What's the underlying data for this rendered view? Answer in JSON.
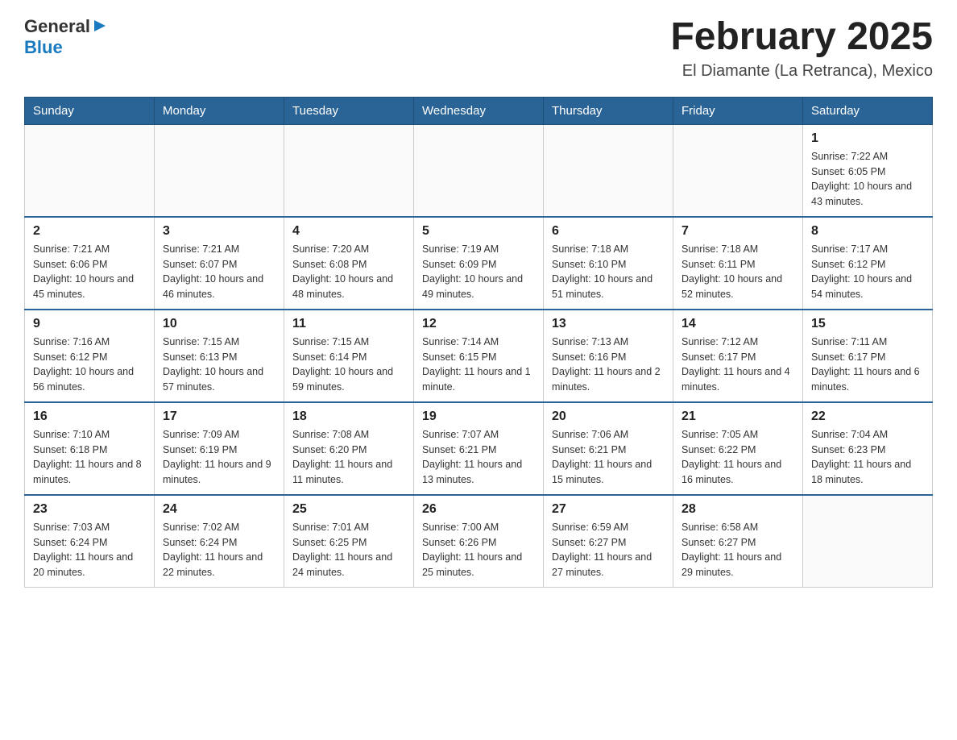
{
  "header": {
    "logo_general": "General",
    "logo_blue": "Blue",
    "month_title": "February 2025",
    "location": "El Diamante (La Retranca), Mexico"
  },
  "days_of_week": [
    "Sunday",
    "Monday",
    "Tuesday",
    "Wednesday",
    "Thursday",
    "Friday",
    "Saturday"
  ],
  "weeks": [
    {
      "days": [
        {
          "num": "",
          "sunrise": "",
          "sunset": "",
          "daylight": "",
          "empty": true
        },
        {
          "num": "",
          "sunrise": "",
          "sunset": "",
          "daylight": "",
          "empty": true
        },
        {
          "num": "",
          "sunrise": "",
          "sunset": "",
          "daylight": "",
          "empty": true
        },
        {
          "num": "",
          "sunrise": "",
          "sunset": "",
          "daylight": "",
          "empty": true
        },
        {
          "num": "",
          "sunrise": "",
          "sunset": "",
          "daylight": "",
          "empty": true
        },
        {
          "num": "",
          "sunrise": "",
          "sunset": "",
          "daylight": "",
          "empty": true
        },
        {
          "num": "1",
          "sunrise": "Sunrise: 7:22 AM",
          "sunset": "Sunset: 6:05 PM",
          "daylight": "Daylight: 10 hours and 43 minutes.",
          "empty": false
        }
      ]
    },
    {
      "days": [
        {
          "num": "2",
          "sunrise": "Sunrise: 7:21 AM",
          "sunset": "Sunset: 6:06 PM",
          "daylight": "Daylight: 10 hours and 45 minutes.",
          "empty": false
        },
        {
          "num": "3",
          "sunrise": "Sunrise: 7:21 AM",
          "sunset": "Sunset: 6:07 PM",
          "daylight": "Daylight: 10 hours and 46 minutes.",
          "empty": false
        },
        {
          "num": "4",
          "sunrise": "Sunrise: 7:20 AM",
          "sunset": "Sunset: 6:08 PM",
          "daylight": "Daylight: 10 hours and 48 minutes.",
          "empty": false
        },
        {
          "num": "5",
          "sunrise": "Sunrise: 7:19 AM",
          "sunset": "Sunset: 6:09 PM",
          "daylight": "Daylight: 10 hours and 49 minutes.",
          "empty": false
        },
        {
          "num": "6",
          "sunrise": "Sunrise: 7:18 AM",
          "sunset": "Sunset: 6:10 PM",
          "daylight": "Daylight: 10 hours and 51 minutes.",
          "empty": false
        },
        {
          "num": "7",
          "sunrise": "Sunrise: 7:18 AM",
          "sunset": "Sunset: 6:11 PM",
          "daylight": "Daylight: 10 hours and 52 minutes.",
          "empty": false
        },
        {
          "num": "8",
          "sunrise": "Sunrise: 7:17 AM",
          "sunset": "Sunset: 6:12 PM",
          "daylight": "Daylight: 10 hours and 54 minutes.",
          "empty": false
        }
      ]
    },
    {
      "days": [
        {
          "num": "9",
          "sunrise": "Sunrise: 7:16 AM",
          "sunset": "Sunset: 6:12 PM",
          "daylight": "Daylight: 10 hours and 56 minutes.",
          "empty": false
        },
        {
          "num": "10",
          "sunrise": "Sunrise: 7:15 AM",
          "sunset": "Sunset: 6:13 PM",
          "daylight": "Daylight: 10 hours and 57 minutes.",
          "empty": false
        },
        {
          "num": "11",
          "sunrise": "Sunrise: 7:15 AM",
          "sunset": "Sunset: 6:14 PM",
          "daylight": "Daylight: 10 hours and 59 minutes.",
          "empty": false
        },
        {
          "num": "12",
          "sunrise": "Sunrise: 7:14 AM",
          "sunset": "Sunset: 6:15 PM",
          "daylight": "Daylight: 11 hours and 1 minute.",
          "empty": false
        },
        {
          "num": "13",
          "sunrise": "Sunrise: 7:13 AM",
          "sunset": "Sunset: 6:16 PM",
          "daylight": "Daylight: 11 hours and 2 minutes.",
          "empty": false
        },
        {
          "num": "14",
          "sunrise": "Sunrise: 7:12 AM",
          "sunset": "Sunset: 6:17 PM",
          "daylight": "Daylight: 11 hours and 4 minutes.",
          "empty": false
        },
        {
          "num": "15",
          "sunrise": "Sunrise: 7:11 AM",
          "sunset": "Sunset: 6:17 PM",
          "daylight": "Daylight: 11 hours and 6 minutes.",
          "empty": false
        }
      ]
    },
    {
      "days": [
        {
          "num": "16",
          "sunrise": "Sunrise: 7:10 AM",
          "sunset": "Sunset: 6:18 PM",
          "daylight": "Daylight: 11 hours and 8 minutes.",
          "empty": false
        },
        {
          "num": "17",
          "sunrise": "Sunrise: 7:09 AM",
          "sunset": "Sunset: 6:19 PM",
          "daylight": "Daylight: 11 hours and 9 minutes.",
          "empty": false
        },
        {
          "num": "18",
          "sunrise": "Sunrise: 7:08 AM",
          "sunset": "Sunset: 6:20 PM",
          "daylight": "Daylight: 11 hours and 11 minutes.",
          "empty": false
        },
        {
          "num": "19",
          "sunrise": "Sunrise: 7:07 AM",
          "sunset": "Sunset: 6:21 PM",
          "daylight": "Daylight: 11 hours and 13 minutes.",
          "empty": false
        },
        {
          "num": "20",
          "sunrise": "Sunrise: 7:06 AM",
          "sunset": "Sunset: 6:21 PM",
          "daylight": "Daylight: 11 hours and 15 minutes.",
          "empty": false
        },
        {
          "num": "21",
          "sunrise": "Sunrise: 7:05 AM",
          "sunset": "Sunset: 6:22 PM",
          "daylight": "Daylight: 11 hours and 16 minutes.",
          "empty": false
        },
        {
          "num": "22",
          "sunrise": "Sunrise: 7:04 AM",
          "sunset": "Sunset: 6:23 PM",
          "daylight": "Daylight: 11 hours and 18 minutes.",
          "empty": false
        }
      ]
    },
    {
      "days": [
        {
          "num": "23",
          "sunrise": "Sunrise: 7:03 AM",
          "sunset": "Sunset: 6:24 PM",
          "daylight": "Daylight: 11 hours and 20 minutes.",
          "empty": false
        },
        {
          "num": "24",
          "sunrise": "Sunrise: 7:02 AM",
          "sunset": "Sunset: 6:24 PM",
          "daylight": "Daylight: 11 hours and 22 minutes.",
          "empty": false
        },
        {
          "num": "25",
          "sunrise": "Sunrise: 7:01 AM",
          "sunset": "Sunset: 6:25 PM",
          "daylight": "Daylight: 11 hours and 24 minutes.",
          "empty": false
        },
        {
          "num": "26",
          "sunrise": "Sunrise: 7:00 AM",
          "sunset": "Sunset: 6:26 PM",
          "daylight": "Daylight: 11 hours and 25 minutes.",
          "empty": false
        },
        {
          "num": "27",
          "sunrise": "Sunrise: 6:59 AM",
          "sunset": "Sunset: 6:27 PM",
          "daylight": "Daylight: 11 hours and 27 minutes.",
          "empty": false
        },
        {
          "num": "28",
          "sunrise": "Sunrise: 6:58 AM",
          "sunset": "Sunset: 6:27 PM",
          "daylight": "Daylight: 11 hours and 29 minutes.",
          "empty": false
        },
        {
          "num": "",
          "sunrise": "",
          "sunset": "",
          "daylight": "",
          "empty": true
        }
      ]
    }
  ]
}
